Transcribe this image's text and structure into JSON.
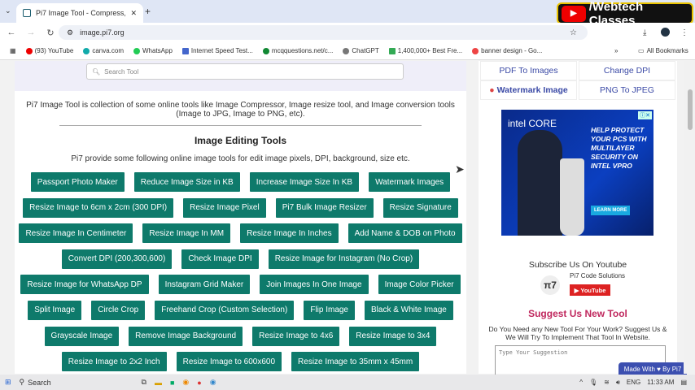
{
  "browser": {
    "tab_title": "Pi7 Image Tool - Compress, Re",
    "url": "image.pi7.org",
    "bookmarks": [
      "(93) YouTube",
      "canva.com",
      "WhatsApp",
      "Internet Speed Test...",
      "mcqquestions.net/c...",
      "ChatGPT",
      "1,400,000+ Best Fre...",
      "banner design - Go..."
    ],
    "all_bookmarks": "All Bookmarks"
  },
  "overlay": {
    "channel": "/Webtech Classes"
  },
  "main": {
    "search_placeholder": "Search Tool",
    "intro": "Pi7 Image Tool is collection of some online tools like Image Compressor, Image resize tool, and Image conversion tools (Image to JPG, Image to PNG, etc).",
    "heading": "Image Editing Tools",
    "subtext": "Pi7 provide some following online image tools for edit image pixels, DPI, background, size etc.",
    "rows": [
      [
        "Passport Photo Maker",
        "Reduce Image Size in KB",
        "Increase Image Size In KB",
        "Watermark Images"
      ],
      [
        "Resize Image to 6cm x 2cm (300 DPI)",
        "Resize Image Pixel",
        "Pi7 Bulk Image Resizer",
        "Resize Signature"
      ],
      [
        "Resize Image In Centimeter",
        "Resize Image In MM",
        "Resize Image In Inches",
        "Add Name & DOB on Photo"
      ],
      [
        "Convert DPI (200,300,600)",
        "Check Image DPI",
        "Resize Image for Instagram (No Crop)"
      ],
      [
        "Resize Image for WhatsApp DP",
        "Instagram Grid Maker",
        "Join Images In One Image",
        "Image Color Picker"
      ],
      [
        "Split Image",
        "Circle Crop",
        "Freehand Crop (Custom Selection)",
        "Flip Image",
        "Black & White Image"
      ],
      [
        "Grayscale Image",
        "Remove Image Background",
        "Resize Image to 4x6",
        "Resize Image to 3x4"
      ],
      [
        "Resize Image to 2x2 Inch",
        "Resize Image to 600x600",
        "Resize Image to 35mm x 45mm"
      ]
    ]
  },
  "sidebar": {
    "links": [
      "PDF To Images",
      "Change DPI",
      "Watermark Image",
      "PNG To JPEG"
    ],
    "ad": {
      "brand": "intel CORE",
      "headline": "HELP PROTECT YOUR PCS WITH MULTILAYER SECURITY ON INTEL VPRO",
      "cta": "LEARN MORE"
    },
    "subscribe": "Subscribe Us On Youtube",
    "channel_name": "Pi7 Code Solutions",
    "yt_button": "YouTube",
    "suggest_title": "Suggest Us New Tool",
    "suggest_text": "Do You Need any New Tool For Your Work? Suggest Us & We Will Try To Implement That Tool In Website.",
    "suggest_placeholder": "Type Your Suggestion",
    "made_with": "Made With ♥ By  Pi7"
  },
  "taskbar": {
    "search": "Search",
    "lang": "ENG",
    "time": "11:33 AM"
  },
  "colors": {
    "button": "#0e7a6b",
    "link": "#3b4aa6",
    "suggest_title": "#c0285e"
  }
}
